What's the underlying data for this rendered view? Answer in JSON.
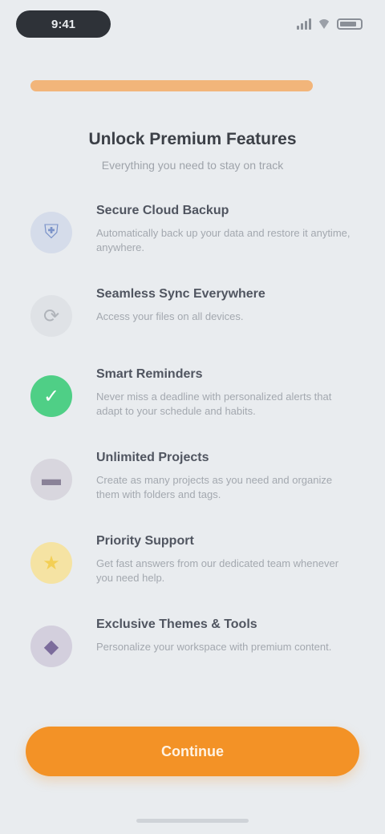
{
  "status_bar": {
    "time": "9:41"
  },
  "onboarding": {
    "progress_percent": 100,
    "title": "Unlock Premium Features",
    "subtitle": "Everything you need to stay on track",
    "cta_label": "Continue"
  },
  "features": [
    {
      "icon": "shield-icon",
      "icon_glyph": "⛨",
      "icon_color": "#7b93c9",
      "icon_bg": "#d5dcea",
      "title": "Secure Cloud Backup",
      "description": "Automatically back up your data and restore it anytime, anywhere."
    },
    {
      "icon": "sync-icon",
      "icon_glyph": "⟳",
      "icon_color": "#b0b4ba",
      "icon_bg": "#dfe2e6",
      "title": "Seamless Sync Everywhere",
      "description": "Access your files on all devices."
    },
    {
      "icon": "check-circle-icon",
      "icon_glyph": "✓",
      "icon_color": "#ffffff",
      "icon_bg": "#4fcf86",
      "title": "Smart Reminders",
      "description": "Never miss a deadline with personalized alerts that adapt to your schedule and habits."
    },
    {
      "icon": "folder-icon",
      "icon_glyph": "▬",
      "icon_color": "#8a8298",
      "icon_bg": "#d8d6de",
      "title": "Unlimited Projects",
      "description": "Create as many projects as you need and organize them with folders and tags."
    },
    {
      "icon": "star-icon",
      "icon_glyph": "★",
      "icon_color": "#f3cf55",
      "icon_bg": "#f5e3a3",
      "title": "Priority Support",
      "description": "Get fast answers from our dedicated team whenever you need help."
    },
    {
      "icon": "gem-icon",
      "icon_glyph": "◆",
      "icon_color": "#7c6c9c",
      "icon_bg": "#d3cfdd",
      "title": "Exclusive Themes & Tools",
      "description": "Personalize your workspace with premium content."
    }
  ],
  "colors": {
    "accent": "#f39226",
    "background": "#e9ecef"
  }
}
